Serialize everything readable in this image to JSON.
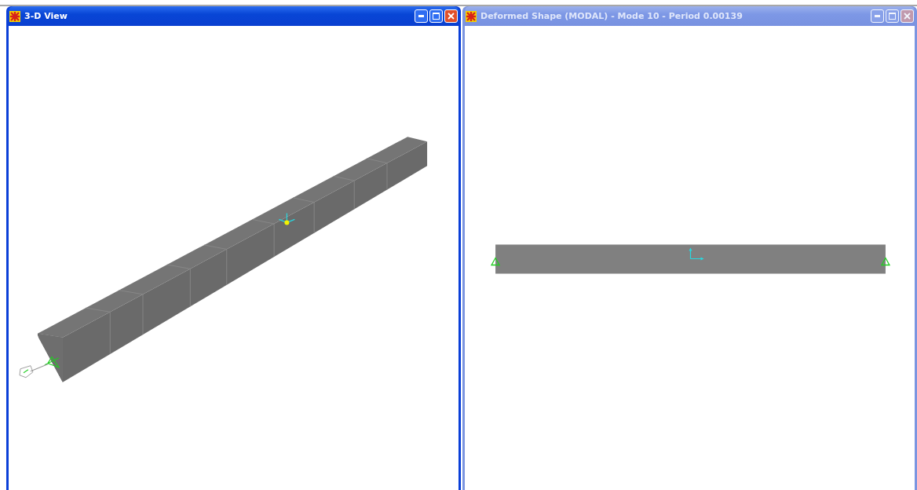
{
  "windows": [
    {
      "title": "3-D View",
      "active": true,
      "kind": "perspective"
    },
    {
      "title": "Deformed Shape (MODAL) - Mode 10 - Period 0.00139",
      "active": false,
      "kind": "elevation"
    }
  ]
}
